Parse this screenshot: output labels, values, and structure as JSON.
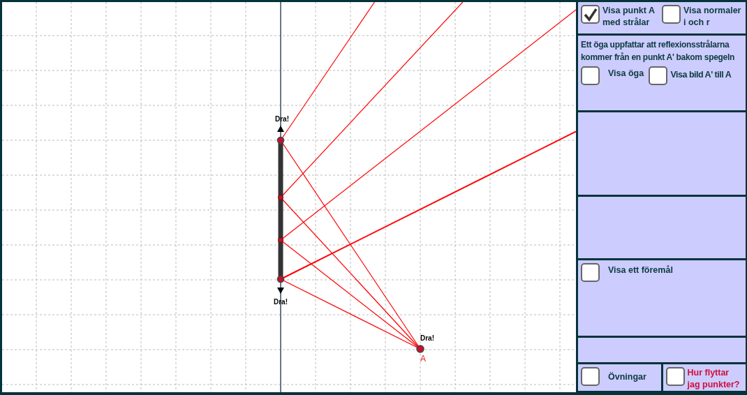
{
  "canvas": {
    "drag_labels": [
      "Dra!",
      "Dra!",
      "Dra!"
    ],
    "point_label": "A"
  },
  "panel": {
    "rows": [
      {
        "checkboxes": [
          {
            "label": "Visa punkt A med strålar",
            "checked": true,
            "color": "#0d3a3e"
          },
          {
            "label": "Visa normaler i och r",
            "checked": false,
            "color": "#0d3a3e"
          }
        ]
      },
      {
        "text": "Ett öga uppfattar att reflexionsstrålarna kommer från en punkt A' bakom spegeln",
        "checkboxes": [
          {
            "label": "Visa öga",
            "checked": false,
            "color": "#0d3a3e"
          },
          {
            "label": "Visa bild A' till A",
            "checked": false,
            "color": "#0d3a3e"
          }
        ]
      },
      {},
      {},
      {
        "checkboxes": [
          {
            "label": "Visa ett föremål",
            "checked": false,
            "color": "#0d3a3e"
          }
        ]
      },
      {},
      {
        "checkboxes": [
          {
            "label": "Övningar",
            "checked": false,
            "color": "#0d3a3e"
          },
          {
            "label": "Hur flyttar jag punkter?",
            "checked": false,
            "color": "#d0103a"
          }
        ]
      }
    ]
  }
}
